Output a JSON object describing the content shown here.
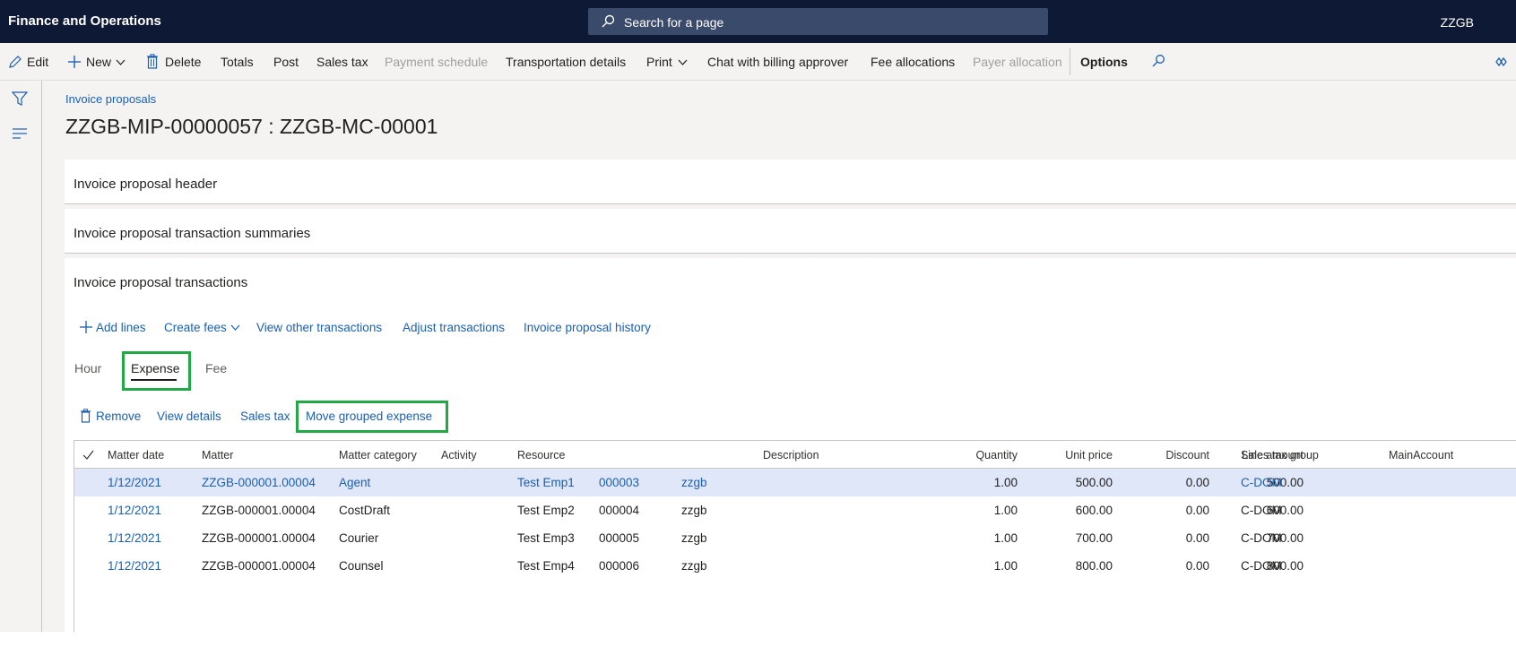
{
  "topbar": {
    "app_title": "Finance and Operations",
    "search_placeholder": "Search for a page",
    "company": "ZZGB"
  },
  "action_pane": {
    "edit": "Edit",
    "new": "New",
    "delete": "Delete",
    "totals": "Totals",
    "post": "Post",
    "sales_tax": "Sales tax",
    "payment_schedule": "Payment schedule",
    "transportation_details": "Transportation details",
    "print": "Print",
    "chat": "Chat with billing approver",
    "fee_allocations": "Fee allocations",
    "payer_allocation": "Payer allocation",
    "options": "Options"
  },
  "breadcrumb": "Invoice proposals",
  "page_title": "ZZGB-MIP-00000057 : ZZGB-MC-00001",
  "fasttabs": {
    "header": "Invoice proposal header",
    "summaries": "Invoice proposal transaction summaries",
    "transactions": "Invoice proposal transactions"
  },
  "transactions_toolbar": {
    "add_lines": "Add lines",
    "create_fees": "Create fees",
    "view_other": "View other transactions",
    "adjust": "Adjust transactions",
    "history": "Invoice proposal history"
  },
  "tabs": {
    "hour": "Hour",
    "expense": "Expense",
    "fee": "Fee"
  },
  "grid_toolbar": {
    "remove": "Remove",
    "view_details": "View details",
    "sales_tax": "Sales tax",
    "move_grouped": "Move grouped expense"
  },
  "grid": {
    "headers": {
      "matter_date": "Matter date",
      "matter": "Matter",
      "matter_category": "Matter category",
      "activity": "Activity",
      "resource": "Resource",
      "description": "Description",
      "quantity": "Quantity",
      "unit_price": "Unit price",
      "discount": "Discount",
      "line_amount": "Line amount",
      "sales_tax_group": "Sales tax group",
      "main_account": "MainAccount"
    },
    "rows": [
      {
        "date": "1/12/2021",
        "matter": "ZZGB-000001.00004",
        "category": "Agent",
        "resource_name": "Test Emp1",
        "resource_id": "000003",
        "resource_co": "zzgb",
        "quantity": "1.00",
        "unit_price": "500.00",
        "discount": "0.00",
        "line_amount": "500.00",
        "tax_group": "C-DOM"
      },
      {
        "date": "1/12/2021",
        "matter": "ZZGB-000001.00004",
        "category": "CostDraft",
        "resource_name": "Test Emp2",
        "resource_id": "000004",
        "resource_co": "zzgb",
        "quantity": "1.00",
        "unit_price": "600.00",
        "discount": "0.00",
        "line_amount": "600.00",
        "tax_group": "C-DOM"
      },
      {
        "date": "1/12/2021",
        "matter": "ZZGB-000001.00004",
        "category": "Courier",
        "resource_name": "Test Emp3",
        "resource_id": "000005",
        "resource_co": "zzgb",
        "quantity": "1.00",
        "unit_price": "700.00",
        "discount": "0.00",
        "line_amount": "700.00",
        "tax_group": "C-DOM"
      },
      {
        "date": "1/12/2021",
        "matter": "ZZGB-000001.00004",
        "category": "Counsel",
        "resource_name": "Test Emp4",
        "resource_id": "000006",
        "resource_co": "zzgb",
        "quantity": "1.00",
        "unit_price": "800.00",
        "discount": "0.00",
        "line_amount": "800.00",
        "tax_group": "C-DOM"
      }
    ]
  }
}
